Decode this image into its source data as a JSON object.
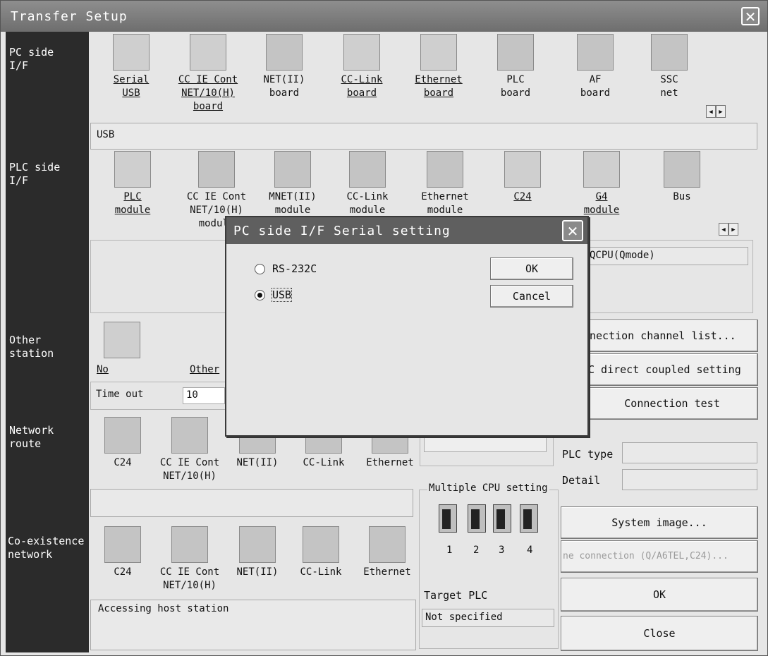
{
  "window": {
    "title": "Transfer Setup"
  },
  "sidebar": {
    "pc_side": "PC side\nI/F",
    "plc_side": "PLC side\nI/F",
    "other_station": "Other\nstation",
    "network_route": "Network\nroute",
    "coexistence": "Co-existence\nnetwork"
  },
  "pc_side": {
    "items": [
      {
        "label": "Serial\nUSB",
        "icon": "serial-usb-icon"
      },
      {
        "label": "CC IE Cont\nNET/10(H)\nboard",
        "icon": "cc-ie-cont-board-icon"
      },
      {
        "label": "NET(II)\nboard",
        "icon": "net-ii-board-icon"
      },
      {
        "label": "CC-Link\nboard",
        "icon": "cc-link-board-icon"
      },
      {
        "label": "Ethernet\nboard",
        "icon": "ethernet-board-icon"
      },
      {
        "label": "PLC\nboard",
        "icon": "plc-board-icon"
      },
      {
        "label": "AF\nboard",
        "icon": "af-board-icon"
      },
      {
        "label": "SSC\nnet",
        "icon": "ssc-net-icon"
      }
    ],
    "status": "USB"
  },
  "plc_side": {
    "items": [
      {
        "label": "PLC\nmodule",
        "icon": "plc-module-icon"
      },
      {
        "label": "CC IE Cont\nNET/10(H)\nmodule",
        "icon": "cc-ie-cont-module-icon"
      },
      {
        "label": "MNET(II)\nmodule",
        "icon": "mnet-ii-module-icon"
      },
      {
        "label": "CC-Link\nmodule",
        "icon": "cc-link-module-icon"
      },
      {
        "label": "Ethernet\nmodule",
        "icon": "ethernet-module-icon"
      },
      {
        "label": "C24",
        "icon": "c24-icon"
      },
      {
        "label": "G4\nmodule",
        "icon": "g4-module-icon"
      },
      {
        "label": "Bus",
        "icon": "bus-icon"
      }
    ],
    "cpu": "QCPU(Qmode)"
  },
  "other_station": {
    "no_label": "No",
    "other_label": "Other",
    "timeout_label": "Time out",
    "timeout_value": "10"
  },
  "network_route": {
    "items": [
      "C24",
      "CC IE Cont\nNET/10(H)",
      "NET(II)",
      "CC-Link",
      "Ethernet"
    ]
  },
  "coexistence": {
    "items": [
      "C24",
      "CC IE Cont\nNET/10(H)",
      "NET(II)",
      "CC-Link",
      "Ethernet"
    ],
    "status": "Accessing host station"
  },
  "multiple_cpu": {
    "title": "Multiple CPU setting",
    "numbers": [
      "1",
      "2",
      "3",
      "4"
    ],
    "target_label": "Target PLC",
    "target_value": "Not specified"
  },
  "plc_info": {
    "type_label": "PLC type",
    "detail_label": "Detail"
  },
  "buttons": {
    "connection_channel": "nection  channel  list...",
    "direct_coupled": "C direct coupled setting",
    "connection_test": "Connection test",
    "system_image": "System   image...",
    "line_connection": "ne connection (Q/A6TEL,C24)...",
    "ok": "OK",
    "close": "Close"
  },
  "dialog": {
    "title": "PC side I/F  Serial setting",
    "options": [
      "RS-232C",
      "USB"
    ],
    "selected": "USB",
    "ok": "OK",
    "cancel": "Cancel"
  }
}
